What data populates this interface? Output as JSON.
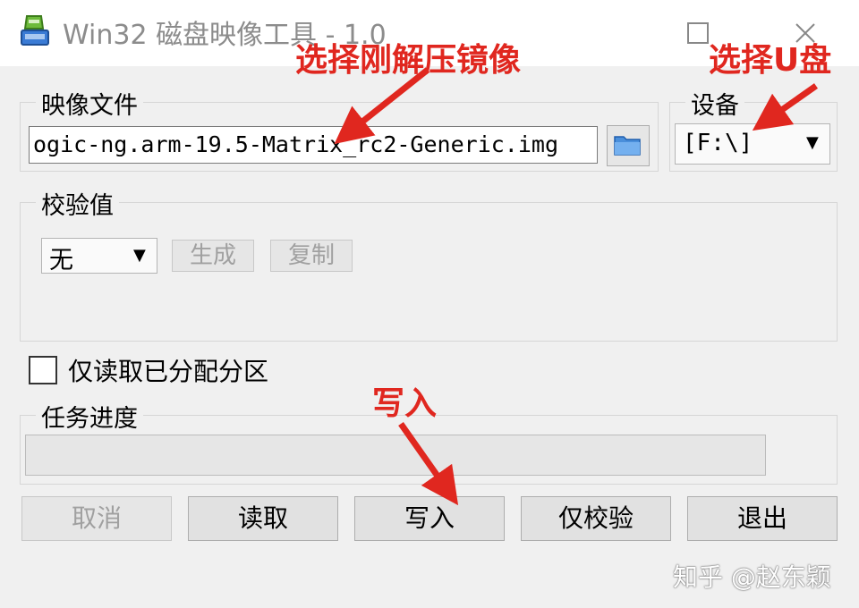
{
  "window": {
    "title": "Win32 磁盘映像工具 - 1.0",
    "icons": {
      "app": "disk-imager-icon",
      "maximize": "maximize-icon",
      "close": "close-icon"
    }
  },
  "image_file": {
    "label": "映像文件",
    "value": "ogic-ng.arm-19.5-Matrix_rc2-Generic.img",
    "browse_icon": "folder-icon"
  },
  "device": {
    "label": "设备",
    "selected": "[F:\\]"
  },
  "hash": {
    "label": "校验值",
    "selected": "无",
    "generate_label": "生成",
    "copy_label": "复制"
  },
  "readonly_partitions": {
    "label": "仅读取已分配分区",
    "checked": false
  },
  "progress": {
    "label": "任务进度",
    "value": 0
  },
  "actions": {
    "cancel": "取消",
    "read": "读取",
    "write": "写入",
    "verify": "仅校验",
    "exit": "退出"
  },
  "annotations": {
    "select_image": "选择刚解压镜像",
    "select_usb": "选择U盘",
    "write": "写入",
    "color": "#e0271f"
  },
  "watermark": "知乎 @赵东颖"
}
